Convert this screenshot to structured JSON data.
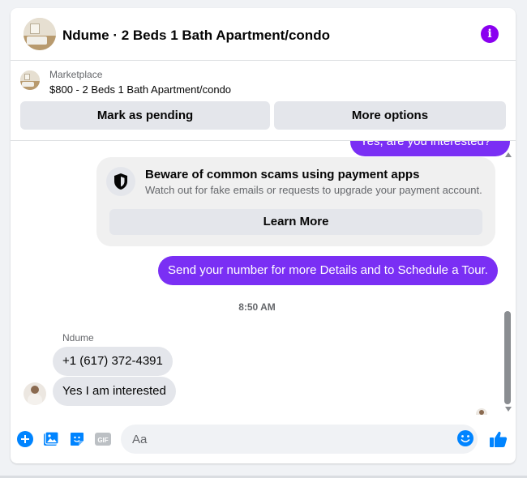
{
  "header": {
    "title": "Ndume · 2 Beds 1 Bath Apartment/condo",
    "info_icon": "info-icon"
  },
  "listing": {
    "label": "Marketplace",
    "price_title": "$800 - 2 Beds 1 Bath Apartment/condo",
    "mark_pending_label": "Mark as pending",
    "more_options_label": "More options"
  },
  "messages": {
    "outgoing_partial": "Yes, are you interested?",
    "warning": {
      "title": "Beware of common scams using payment apps",
      "subtitle": "Watch out for fake emails or requests to upgrade your payment account.",
      "button": "Learn More",
      "icon": "shield-icon"
    },
    "outgoing_main": "Send your number for more Details and to Schedule a Tour.",
    "timestamp": "8:50 AM",
    "sender_name": "Ndume",
    "incoming": [
      "+1 (617) 372-4391",
      "Yes I am interested"
    ]
  },
  "composer": {
    "placeholder": "Aa",
    "icons": [
      "plus-icon",
      "photo-icon",
      "sticker-icon",
      "gif-icon",
      "emoji-icon",
      "thumbs-up-icon"
    ],
    "gif_label": "GIF"
  },
  "colors": {
    "accent": "#7a2ff4",
    "info": "#8a00f0",
    "messenger_blue": "#0084ff"
  }
}
